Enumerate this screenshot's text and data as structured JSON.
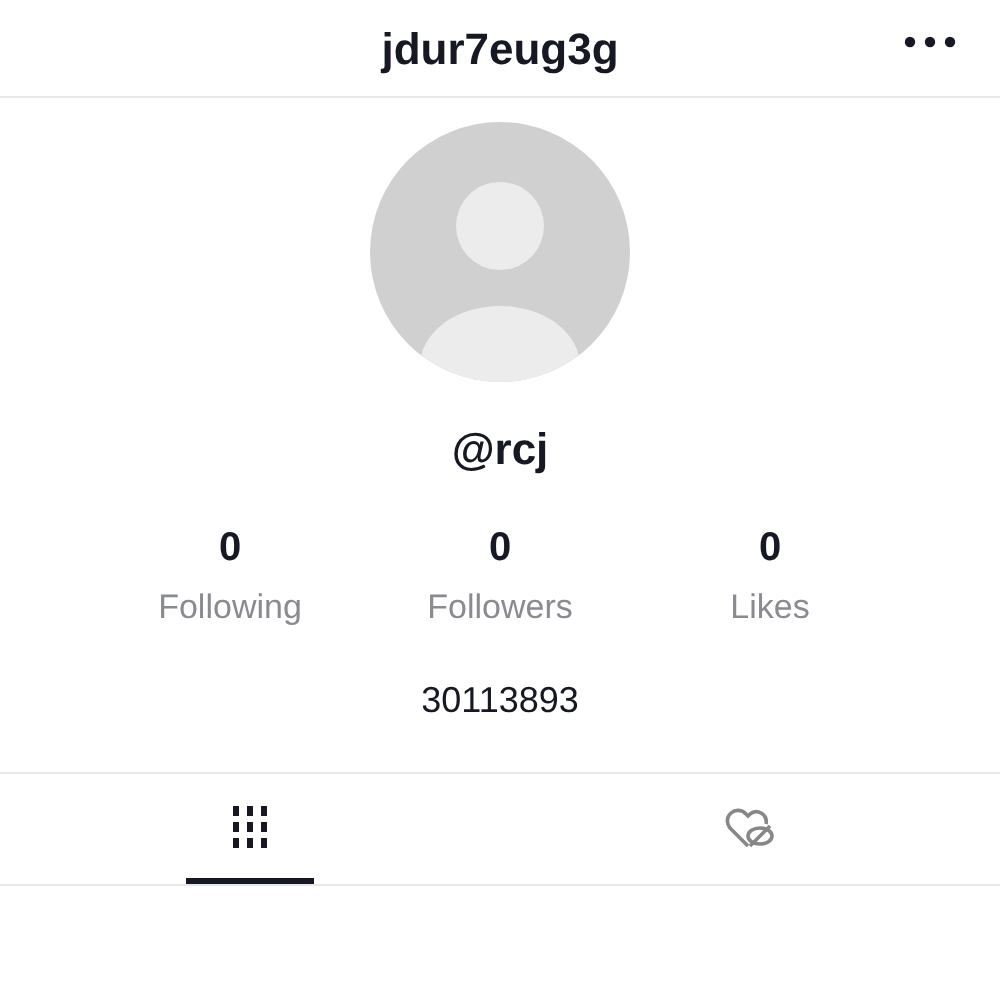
{
  "header": {
    "title": "jdur7eug3g"
  },
  "profile": {
    "handle": "@rcj",
    "bio": "30113893"
  },
  "stats": [
    {
      "value": "0",
      "label": "Following"
    },
    {
      "value": "0",
      "label": "Followers"
    },
    {
      "value": "0",
      "label": "Likes"
    }
  ],
  "tabs": [
    {
      "kind": "grid",
      "selected": true
    },
    {
      "kind": "liked",
      "selected": false
    }
  ]
}
